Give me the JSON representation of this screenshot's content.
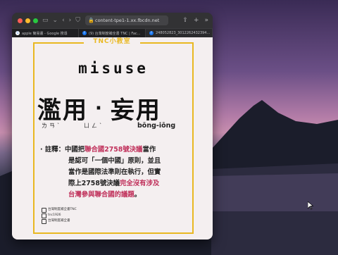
{
  "browser": {
    "url": "content-tpe1-1.xx.fbcdn.net",
    "tabs": [
      {
        "label": "apple 簡易畫 - Google 搜尋",
        "icon": "google-icon"
      },
      {
        "label": "(9) 台灣制度補全書 TNC | Fac...",
        "icon": "facebook-icon"
      },
      {
        "label": "248052823_3012262432394...",
        "icon": "facebook-icon"
      }
    ]
  },
  "post": {
    "banner": "TNC小教室",
    "english": "misuse",
    "chinese_part1": "濫用",
    "chinese_sep": "·",
    "chinese_part2": "妄用",
    "bopomofo_1": "ㄌㄢˋ",
    "bopomofo_2": "ㄩㄥˋ",
    "pinyin": "bōng-iōng",
    "note": {
      "lead": "· 註釋：",
      "l1a": "中國把",
      "l1b": "聯合國2758號決議",
      "l1c": "當作",
      "l2": "是認可「一個中國」原則，並且",
      "l3": "當作是國際法準則在執行，但實",
      "l4a": "際上2758號決議",
      "l4b": "完全沒有涉及",
      "l5a": "台灣參與聯合國的議題",
      "l5b": "。"
    },
    "credits": [
      "台灣制度補全書TNC",
      "tnc1926",
      "台灣制度補全書"
    ]
  },
  "colors": {
    "accent_yellow": "#e9b821",
    "highlight_red": "#c0315b"
  }
}
